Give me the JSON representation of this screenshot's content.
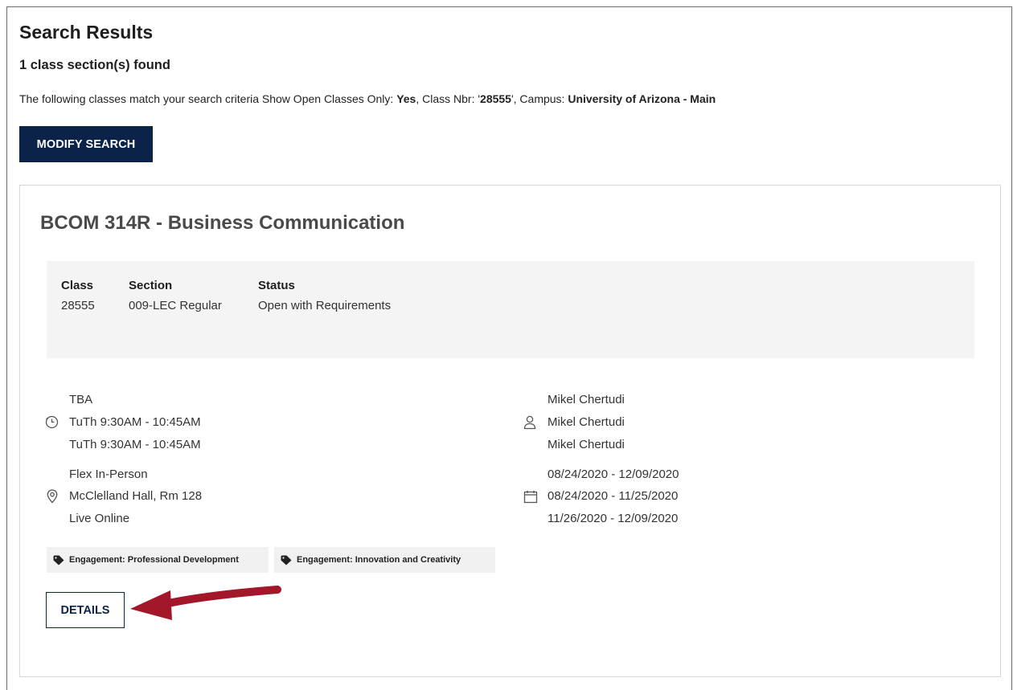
{
  "page": {
    "title": "Search Results",
    "found_text": "1 class section(s) found",
    "criteria": {
      "prefix": "The following classes match your search criteria Show Open Classes Only: ",
      "open_only_value": "Yes",
      "class_nbr_label": ",  Class Nbr: '",
      "class_nbr_value": "28555",
      "campus_label": "',  Campus: ",
      "campus_value": "University of Arizona - Main"
    },
    "modify_button": "MODIFY SEARCH"
  },
  "course": {
    "title": "BCOM 314R - Business Communication",
    "info": {
      "class_header": "Class",
      "class_value": "28555",
      "section_header": "Section",
      "section_value": "009-LEC Regular",
      "status_header": "Status",
      "status_value": "Open with Requirements"
    },
    "schedule": [
      "TBA",
      "TuTh 9:30AM - 10:45AM",
      "TuTh 9:30AM - 10:45AM"
    ],
    "locations": [
      "Flex In-Person",
      "McClelland Hall, Rm 128",
      "Live Online"
    ],
    "instructors": [
      "Mikel Chertudi",
      "Mikel Chertudi",
      "Mikel Chertudi"
    ],
    "dates": [
      "08/24/2020 - 12/09/2020",
      "08/24/2020 - 11/25/2020",
      "11/26/2020 - 12/09/2020"
    ],
    "tags": [
      "Engagement: Professional Development",
      "Engagement: Innovation and Creativity"
    ],
    "details_button": "DETAILS"
  },
  "icons": {
    "schedule": "clock-icon",
    "location": "map-pin-icon",
    "instructor": "person-icon",
    "dates": "calendar-icon",
    "tag": "tag-icon"
  },
  "colors": {
    "primary_button": "#0c2349",
    "annotation_arrow": "#a3172a",
    "panel_background": "#f4f4f5"
  }
}
